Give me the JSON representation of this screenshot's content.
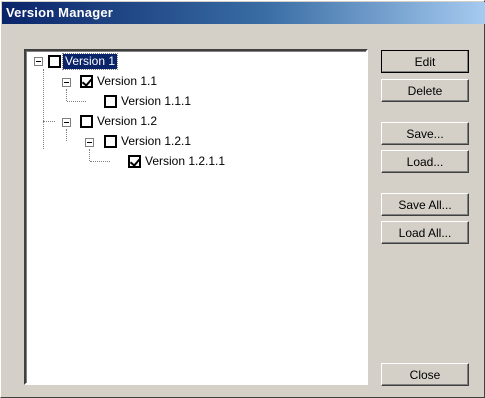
{
  "window": {
    "title": "Version Manager"
  },
  "tree": {
    "nodes": [
      {
        "label": "Version 1",
        "checked": false,
        "selected": true,
        "depth": 0
      },
      {
        "label": "Version 1.1",
        "checked": true,
        "selected": false,
        "depth": 1
      },
      {
        "label": "Version 1.1.1",
        "checked": false,
        "selected": false,
        "depth": 2
      },
      {
        "label": "Version 1.2",
        "checked": false,
        "selected": false,
        "depth": 1
      },
      {
        "label": "Version 1.2.1",
        "checked": false,
        "selected": false,
        "depth": 2
      },
      {
        "label": "Version 1.2.1.1",
        "checked": true,
        "selected": false,
        "depth": 3
      }
    ]
  },
  "buttons": {
    "edit": "Edit",
    "delete": "Delete",
    "save": "Save...",
    "load": "Load...",
    "save_all": "Save All...",
    "load_all": "Load All...",
    "close": "Close"
  },
  "colors": {
    "titlebar_start": "#0a246a",
    "titlebar_end": "#a6caf0",
    "selection": "#0a246a",
    "face": "#d4d0c8"
  }
}
